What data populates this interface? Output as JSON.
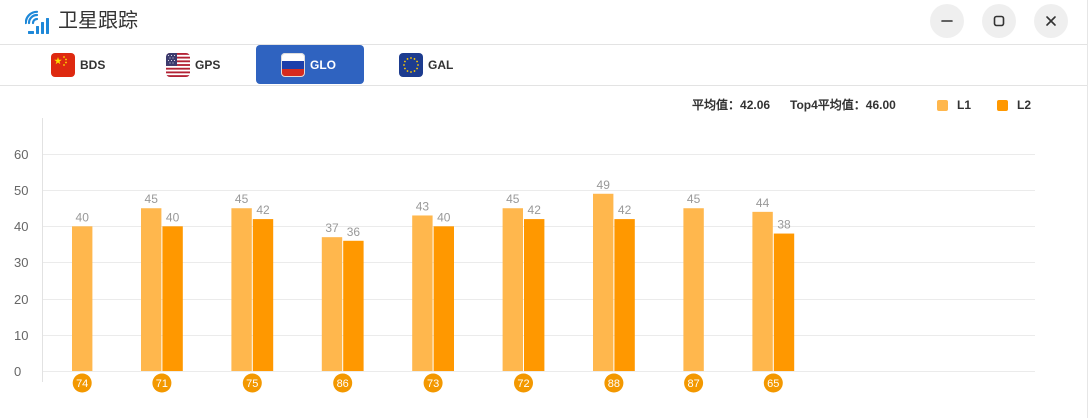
{
  "window": {
    "title": "卫星跟踪",
    "app_icon": "satellite-signal-icon",
    "controls": [
      "minimize-icon",
      "maximize-icon",
      "close-icon"
    ]
  },
  "tabs": [
    {
      "label": "BDS",
      "flag_icon": "china-flag-icon",
      "active": false
    },
    {
      "label": "GPS",
      "flag_icon": "usa-flag-icon",
      "active": false
    },
    {
      "label": "GLO",
      "flag_icon": "russia-flag-icon",
      "active": true
    },
    {
      "label": "GAL",
      "flag_icon": "eu-flag-icon",
      "active": false
    }
  ],
  "stats": {
    "average": {
      "label": "平均值：",
      "value": "42.06"
    },
    "top4_average": {
      "label": "Top4平均值：",
      "value": "46.00"
    }
  },
  "colors": {
    "active_tab": "#2f63c0",
    "app_icon": "#1e88d8",
    "category_badge": "#f39800",
    "value_label": "#999999"
  },
  "chart_data": {
    "type": "bar",
    "categories": [
      "74",
      "71",
      "75",
      "86",
      "73",
      "72",
      "88",
      "87",
      "65"
    ],
    "series": [
      {
        "name": "L1",
        "color": "#ffb74d",
        "values": [
          40,
          45,
          45,
          37,
          43,
          45,
          49,
          45,
          44
        ]
      },
      {
        "name": "L2",
        "color": "#ff9800",
        "values": [
          null,
          40,
          42,
          36,
          40,
          42,
          42,
          null,
          38
        ]
      }
    ],
    "yticks": [
      0,
      10,
      20,
      30,
      40,
      50,
      60
    ],
    "ylim": [
      0,
      60
    ],
    "title": "",
    "xlabel": "",
    "ylabel": "",
    "grid": true,
    "legend": "top-right",
    "value_labels": true
  }
}
